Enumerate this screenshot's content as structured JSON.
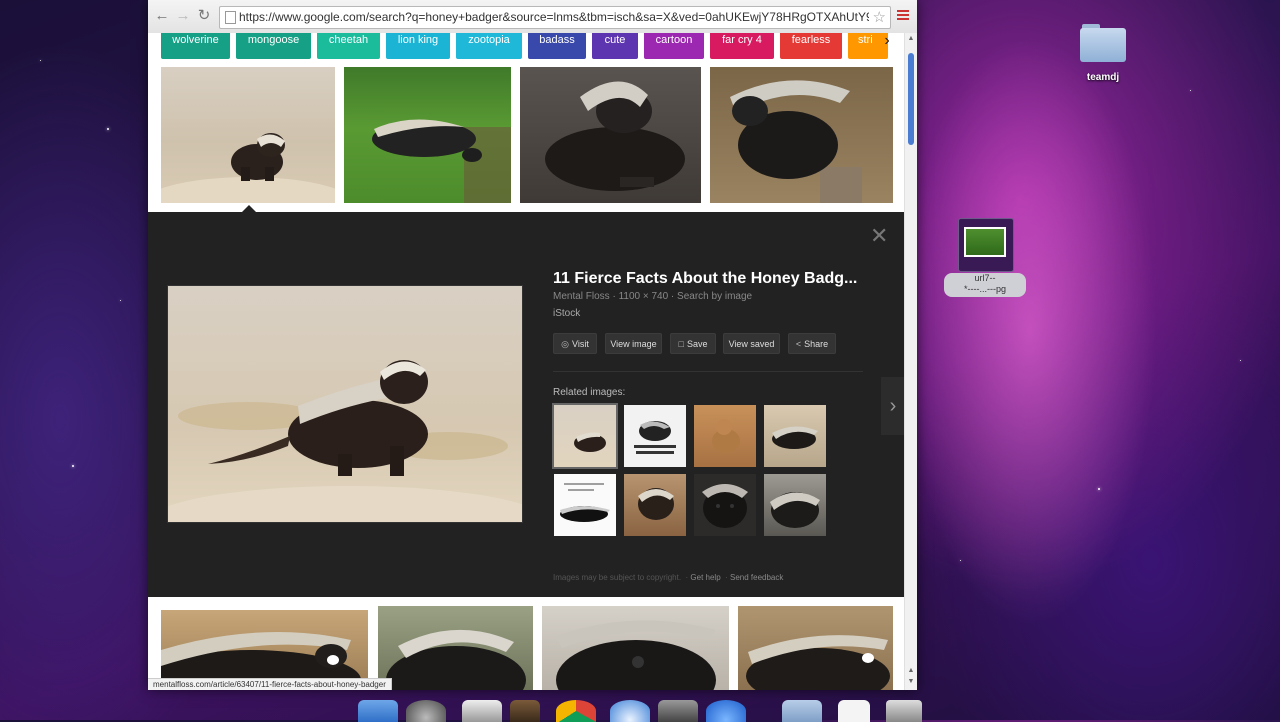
{
  "browser": {
    "url": "https://www.google.com/search?q=honey+badger&source=lnms&tbm=isch&sa=X&ved=0ahUKEwjY78HRgOTXAhUtY9...",
    "status_url": "mentalfloss.com/article/63407/11-fierce-facts-about-honey-badger"
  },
  "chips": [
    "wolverine",
    "mongoose",
    "cheetah",
    "lion king",
    "zootopia",
    "badass",
    "cute",
    "cartoon",
    "far cry 4",
    "fearless",
    "stri"
  ],
  "chip_colors": [
    "#16a085",
    "#16a085",
    "#1abc9c",
    "#1bb4d4",
    "#1fb8d8",
    "#3949ab",
    "#5e35b1",
    "#9c27b0",
    "#d81b60",
    "#e53935",
    "#ff9800"
  ],
  "panel": {
    "title": "11 Fierce Facts About the Honey Badg...",
    "meta": "Mental Floss  ·  1100 × 740  ·  Search by image",
    "source": "iStock",
    "actions": [
      "Visit",
      "View image",
      "Save",
      "View saved",
      "Share"
    ],
    "related_label": "Related images:",
    "footer_note": "Images may be subject to copyright.",
    "footer_help": "Get help",
    "footer_feedback": "Send feedback"
  },
  "desktop": {
    "folder_label": "teamdj",
    "file_label": "url7--\n*----...---pg"
  },
  "colors": {
    "panel_bg": "#222222",
    "accent_blue": "#4a7dd1"
  }
}
